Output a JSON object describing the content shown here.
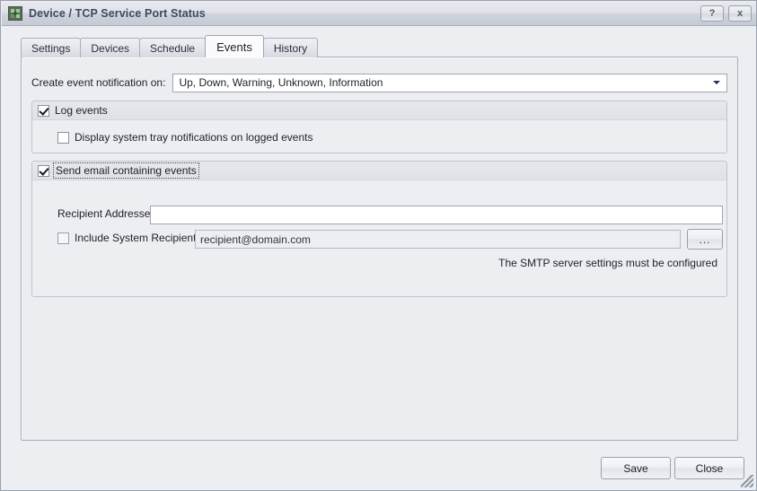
{
  "window": {
    "title": "Device / TCP Service Port Status",
    "icon": "device-monitor-icon",
    "help_label": "?",
    "close_label": "x"
  },
  "tabs": [
    {
      "label": "Settings",
      "active": false
    },
    {
      "label": "Devices",
      "active": false
    },
    {
      "label": "Schedule",
      "active": false
    },
    {
      "label": "Events",
      "active": true
    },
    {
      "label": "History",
      "active": false
    }
  ],
  "events_tab": {
    "notification": {
      "label": "Create event notification on:",
      "value": "Up, Down, Warning, Unknown, Information",
      "arrow_icon": "chevron-down-icon"
    },
    "log_group": {
      "checkbox_label": "Log events",
      "checked": true,
      "tray": {
        "label": "Display system tray notifications on logged events",
        "checked": false
      }
    },
    "email_group": {
      "checkbox_label": "Send email containing events",
      "checked": true,
      "focused": true,
      "recipient_addresses": {
        "label": "Recipient Addresses:",
        "value": "",
        "placeholder": ""
      },
      "include_system": {
        "label": "Include System Recipients:",
        "checked": false,
        "value": "recipient@domain.com",
        "browse_label": "..."
      },
      "smtp_note": "The SMTP server settings must be configured"
    }
  },
  "footer": {
    "save_label": "Save",
    "close_label": "Close"
  }
}
